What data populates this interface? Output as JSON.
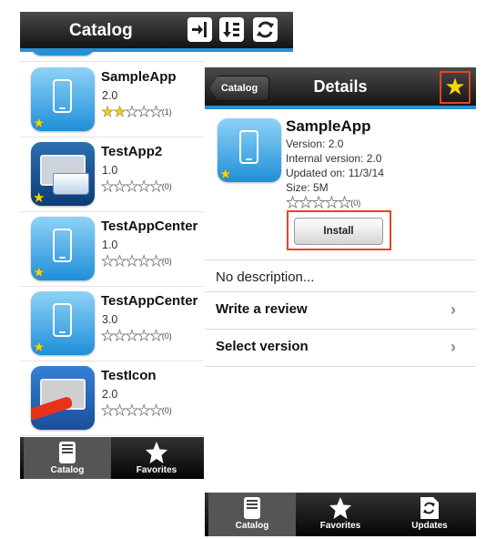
{
  "catalog_screen": {
    "title": "Catalog",
    "toolbar_icons": [
      "login-icon",
      "sort-icon",
      "refresh-icon"
    ],
    "apps": [
      {
        "name": "SampleApp",
        "version": "2.0",
        "rating": 2,
        "review_count": "(1)",
        "icon": "phone-app-icon"
      },
      {
        "name": "TestApp2",
        "version": "1.0",
        "rating": 0,
        "review_count": "(0)",
        "icon": "tablet-folder-icon"
      },
      {
        "name": "TestAppCenter",
        "version": "1.0",
        "rating": 0,
        "review_count": "(0)",
        "icon": "phone-app-icon"
      },
      {
        "name": "TestAppCenter",
        "version": "3.0",
        "rating": 0,
        "review_count": "(0)",
        "icon": "phone-app-icon"
      },
      {
        "name": "TestIcon",
        "version": "2.0",
        "rating": 0,
        "review_count": "(0)",
        "icon": "tablet-icon"
      }
    ],
    "tabs": [
      {
        "label": "Catalog",
        "icon": "catalog-icon",
        "selected": true
      },
      {
        "label": "Favorites",
        "icon": "star-icon",
        "selected": false
      }
    ]
  },
  "details_screen": {
    "back_label": "Catalog",
    "title": "Details",
    "app_name": "SampleApp",
    "version_line": "Version: 2.0",
    "internal_version_line": "Internal version: 2.0",
    "updated_line": "Updated on: 11/3/14",
    "size_line": "Size: 5M",
    "rating": 0,
    "review_count": "(0)",
    "install_label": "Install",
    "description": "No description...",
    "menu": [
      {
        "label": "Write a review"
      },
      {
        "label": "Select version"
      }
    ],
    "tabs": [
      {
        "label": "Catalog",
        "icon": "catalog-icon",
        "selected": true
      },
      {
        "label": "Favorites",
        "icon": "star-icon",
        "selected": false
      },
      {
        "label": "Updates",
        "icon": "updates-icon",
        "selected": false
      }
    ]
  },
  "colors": {
    "accent_blue": "#2a8fd4",
    "highlight_red": "#e8451e",
    "star_yellow": "#f5d40a"
  }
}
